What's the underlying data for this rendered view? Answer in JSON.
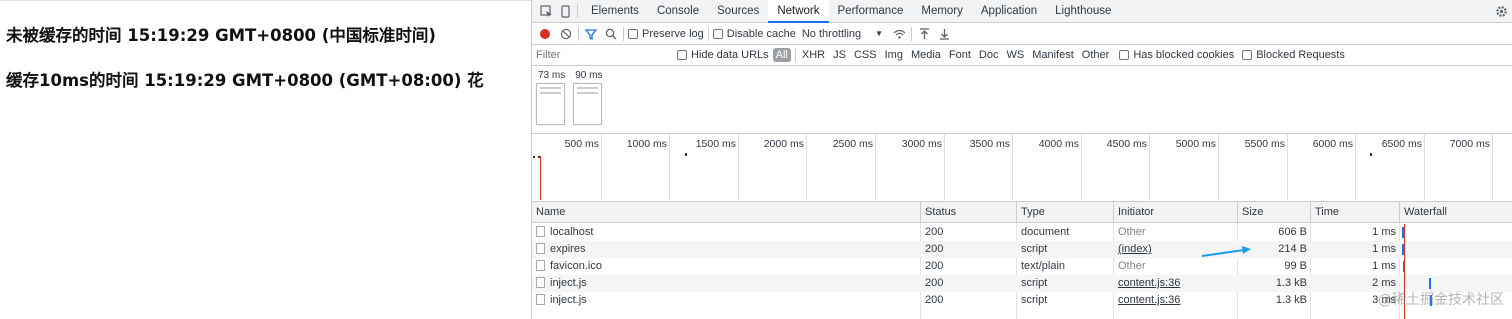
{
  "page": {
    "line1": "未被缓存的时间 15:19:29 GMT+0800 (中国标准时间)",
    "line2": "缓存10ms的时间 15:19:29 GMT+0800 (GMT+08:00) 花"
  },
  "devtools": {
    "tabs": [
      "Elements",
      "Console",
      "Sources",
      "Network",
      "Performance",
      "Memory",
      "Application",
      "Lighthouse"
    ],
    "active_tab": "Network",
    "toolbar": {
      "preserve_log": "Preserve log",
      "disable_cache": "Disable cache",
      "throttling": "No throttling"
    },
    "filter": {
      "placeholder": "Filter",
      "hide_data_urls": "Hide data URLs",
      "types": [
        "All",
        "XHR",
        "JS",
        "CSS",
        "Img",
        "Media",
        "Font",
        "Doc",
        "WS",
        "Manifest",
        "Other"
      ],
      "has_blocked_cookies": "Has blocked cookies",
      "blocked_requests": "Blocked Requests"
    },
    "screenshots": [
      "73 ms",
      "90 ms"
    ],
    "timeline_ticks": [
      "500 ms",
      "1000 ms",
      "1500 ms",
      "2000 ms",
      "2500 ms",
      "3000 ms",
      "3500 ms",
      "4000 ms",
      "4500 ms",
      "5000 ms",
      "5500 ms",
      "6000 ms",
      "6500 ms",
      "7000 ms"
    ],
    "columns": [
      "Name",
      "Status",
      "Type",
      "Initiator",
      "Size",
      "Time",
      "Waterfall"
    ],
    "rows": [
      {
        "name": "localhost",
        "status": "200",
        "type": "document",
        "initiator": "Other",
        "size": "606 B",
        "time": "1 ms"
      },
      {
        "name": "expires",
        "status": "200",
        "type": "script",
        "initiator": "(index)",
        "size": "214 B",
        "time": "1 ms"
      },
      {
        "name": "favicon.ico",
        "status": "200",
        "type": "text/plain",
        "initiator": "Other",
        "size": "99 B",
        "time": "1 ms"
      },
      {
        "name": "inject.js",
        "status": "200",
        "type": "script",
        "initiator": "content.js:36",
        "size": "1.3 kB",
        "time": "2 ms"
      },
      {
        "name": "inject.js",
        "status": "200",
        "type": "script",
        "initiator": "content.js:36",
        "size": "1.3 kB",
        "time": "3 ms"
      }
    ],
    "watermark": "@稀土掘金技术社区",
    "colors": {
      "record": "#d93025",
      "active_tab": "#1a73e8",
      "annotation_arrow": "#1e9be6"
    }
  }
}
